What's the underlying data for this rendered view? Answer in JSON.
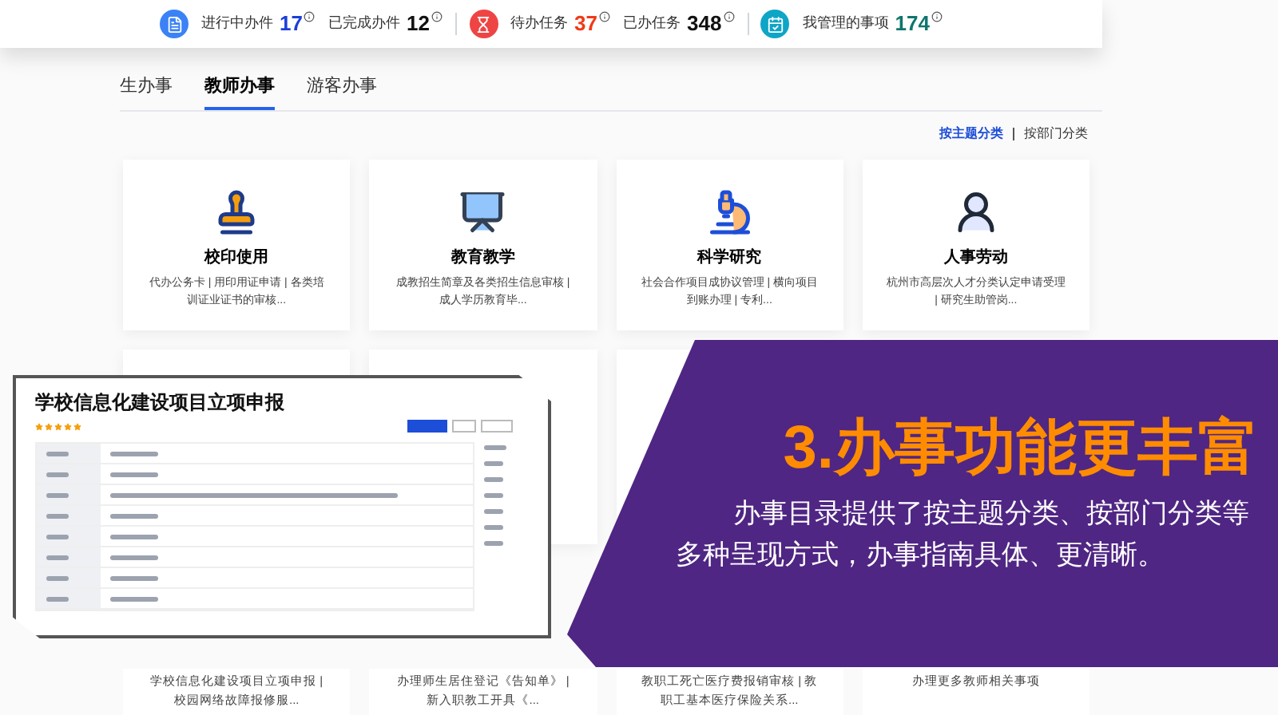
{
  "stats": [
    {
      "kind": "file",
      "items": [
        {
          "label": "进行中办件",
          "value": "17",
          "color": "#1d3fd8"
        },
        {
          "label": "已完成办件",
          "value": "12",
          "color": "#111111"
        }
      ]
    },
    {
      "kind": "hourglass",
      "items": [
        {
          "label": "待办任务",
          "value": "37",
          "color": "#f03a17"
        },
        {
          "label": "已办任务",
          "value": "348",
          "color": "#111111"
        }
      ]
    },
    {
      "kind": "calendar",
      "items": [
        {
          "label": "我管理的事项",
          "value": "174",
          "color": "#0f766e"
        }
      ]
    }
  ],
  "tabs": [
    {
      "label": "生办事",
      "selected": false
    },
    {
      "label": "教师办事",
      "selected": true
    },
    {
      "label": "游客办事",
      "selected": false
    }
  ],
  "category_switch": [
    {
      "label": "按主题分类",
      "selected": true
    },
    {
      "label": "按部门分类",
      "selected": false
    }
  ],
  "cards": [
    {
      "kind": "stamp",
      "title": "校印使用",
      "description": "代办公务卡 | 用印用证申请 | 各类培训证业证书的审核..."
    },
    {
      "kind": "teaching",
      "title": "教育教学",
      "description": "成教招生简章及各类招生信息审核 | 成人学历教育毕..."
    },
    {
      "kind": "research",
      "title": "科学研究",
      "description": "社会合作项目成协议管理 | 横向项目到账办理 | 专利..."
    },
    {
      "kind": "person",
      "title": "人事劳动",
      "description": "杭州市高层次人才分类认定申请受理 | 研究生助管岗..."
    }
  ],
  "bottom_cards": [
    {
      "description": "学校信息化建设项目立项申报 | 校园网络故障报修服..."
    },
    {
      "description": "办理师生居住登记《告知单》 | 新入职教工开具《..."
    },
    {
      "description": "教职工死亡医疗费报销审核 | 教职工基本医疗保险关系..."
    },
    {
      "description": "办理更多教师相关事项"
    }
  ],
  "detail_window": {
    "title": "学校信息化建设项目立项申报",
    "stars": 5
  },
  "promo": {
    "title": "3.办事功能更丰富",
    "text": "办事目录提供了按主题分类、按部门分类等多种呈现方式，办事指南具体、更清晰。"
  }
}
